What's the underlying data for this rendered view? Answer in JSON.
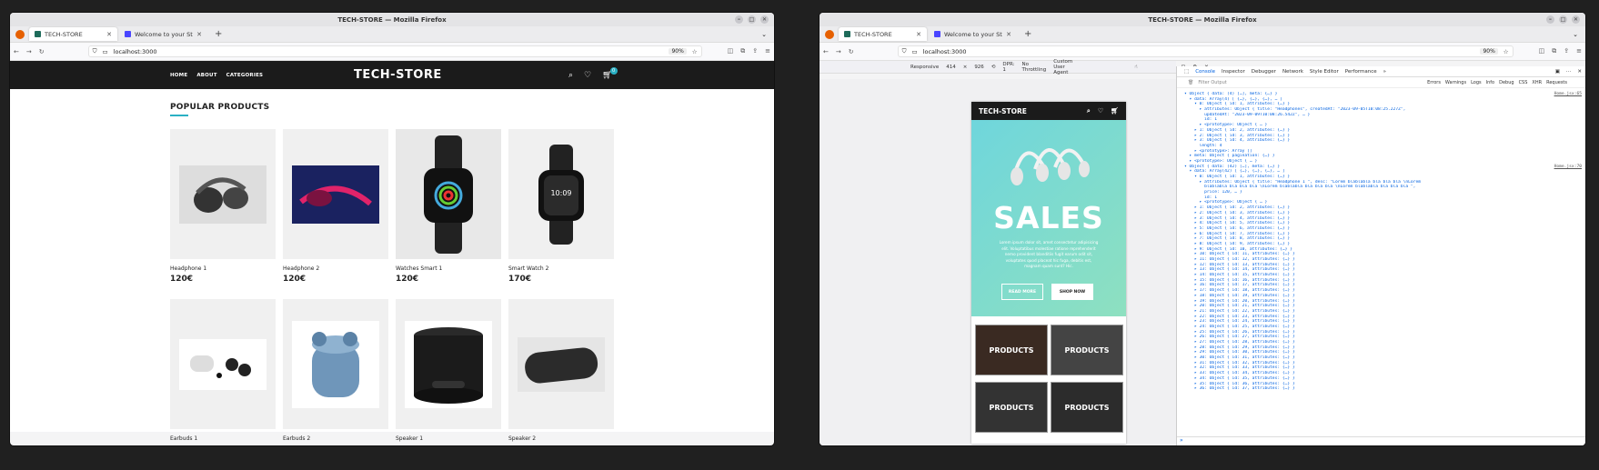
{
  "left_window": {
    "title": "TECH-STORE — Mozilla Firefox",
    "tabs": [
      {
        "label": "TECH-STORE"
      },
      {
        "label": "Welcome to your Strapi a"
      }
    ],
    "url": "localhost:3000",
    "zoom": "90%",
    "store": {
      "nav": [
        "HOME",
        "ABOUT",
        "CATEGORIES"
      ],
      "logo": "TECH-STORE",
      "cart_count": "0",
      "section_title": "POPULAR PRODUCTS",
      "products": [
        {
          "name": "Headphone 1",
          "price": "120€",
          "icon": "headphone-icon"
        },
        {
          "name": "Headphone 2",
          "price": "120€",
          "icon": "headphone-icon"
        },
        {
          "name": "Watches Smart 1",
          "price": "120€",
          "icon": "watch-icon"
        },
        {
          "name": "Smart Watch 2",
          "price": "170€",
          "icon": "watch-icon"
        },
        {
          "name": "Earbuds 1",
          "price": "",
          "icon": "earbuds-icon"
        },
        {
          "name": "Earbuds 2",
          "price": "",
          "icon": "earbuds-icon"
        },
        {
          "name": "Speaker 1",
          "price": "",
          "icon": "speaker-icon"
        },
        {
          "name": "Speaker 2",
          "price": "",
          "icon": "speaker-icon"
        }
      ]
    }
  },
  "right_window": {
    "title": "TECH-STORE — Mozilla Firefox",
    "tabs": [
      {
        "label": "TECH-STORE"
      },
      {
        "label": "Welcome to your Strapi a"
      }
    ],
    "url": "localhost:3000",
    "zoom": "90%",
    "rdm": {
      "device": "Responsive",
      "width": "414",
      "height": "926",
      "dpr": "DPR: 1",
      "throttle": "No Throttling",
      "ua": "Custom User Agent"
    },
    "phone": {
      "logo": "TECH-STORE",
      "hero_title": "SALES",
      "hero_text": "Lorem ipsum dolor sit, amet consectetur adipisicing elit. Voluptatibus molestiae ratione reprehenderit nemo provident blanditiis fugit earum odit sit, voluptates quod placeat hic fuga, debitis est, magnam quam sunt? Hic.",
      "read_more": "READ MORE",
      "shop_now": "SHOP NOW",
      "categories": [
        "PRODUCTS",
        "PRODUCTS",
        "PRODUCTS",
        "PRODUCTS"
      ]
    },
    "devtools": {
      "tabs": [
        "Console",
        "Inspector",
        "Debugger",
        "Network",
        "Style Editor",
        "Performance"
      ],
      "filter_placeholder": "Filter Output",
      "levels": [
        "Errors",
        "Warnings",
        "Logs",
        "Info",
        "Debug",
        "CSS",
        "XHR",
        "Requests"
      ],
      "source1": "Home.jsx:65",
      "source2": "Home.jsx:70",
      "log_lines": [
        "▾ Object { data: (4) […], meta: {…} }",
        "  ▾ data: Array(4) [ {…}, {…}, {…}, … ]",
        "    ▾ 0: Object { id: 1, attributes: {…} }",
        "      ▸ attributes: Object { title: \"Headphones\", createdAt: \"2023-09-05T10:08:25.227Z\",",
        "        updatedAt: \"2023-09-09T10:08:26.542Z\", … }",
        "        id: 1",
        "      ▸ <prototype>: Object { … }",
        "    ▸ 1: Object { id: 2, attributes: {…} }",
        "    ▸ 2: Object { id: 3, attributes: {…} }",
        "    ▸ 3: Object { id: 4, attributes: {…} }",
        "      length: 4",
        "    ▸ <prototype>: Array []",
        "  ▸ meta: Object { pagination: {…} }",
        "  ▸ <prototype>: Object { … }",
        "▾ Object { data: (42) […], meta: {…} }",
        "  ▾ data: Array(42) [ {…}, {…}, {…}, … ]",
        "    ▾ 0: Object { id: 1, attributes: {…} }",
        "      ▸ attributes: Object { title: \"Headphone 1 \", desc: \"Lorem blablabla bla bla bla \\nLorem",
        "        blablabla bla bla bla \\nLorem blablabla bla bla bla \\nLorem blablabla bla bla bla \",",
        "        price: 120, … }",
        "        id: 1",
        "      ▸ <prototype>: Object { … }",
        "    ▸ 1: Object { id: 2, attributes: {…} }",
        "    ▸ 2: Object { id: 3, attributes: {…} }",
        "    ▸ 3: Object { id: 4, attributes: {…} }",
        "    ▸ 4: Object { id: 5, attributes: {…} }",
        "    ▸ 5: Object { id: 6, attributes: {…} }",
        "    ▸ 6: Object { id: 7, attributes: {…} }",
        "    ▸ 7: Object { id: 8, attributes: {…} }",
        "    ▸ 8: Object { id: 9, attributes: {…} }",
        "    ▸ 9: Object { id: 10, attributes: {…} }",
        "    ▸ 10: Object { id: 11, attributes: {…} }",
        "    ▸ 11: Object { id: 12, attributes: {…} }",
        "    ▸ 12: Object { id: 13, attributes: {…} }",
        "    ▸ 13: Object { id: 14, attributes: {…} }",
        "    ▸ 14: Object { id: 15, attributes: {…} }",
        "    ▸ 15: Object { id: 16, attributes: {…} }",
        "    ▸ 16: Object { id: 17, attributes: {…} }",
        "    ▸ 17: Object { id: 18, attributes: {…} }",
        "    ▸ 18: Object { id: 19, attributes: {…} }",
        "    ▸ 19: Object { id: 20, attributes: {…} }",
        "    ▸ 20: Object { id: 21, attributes: {…} }",
        "    ▸ 21: Object { id: 22, attributes: {…} }",
        "    ▸ 22: Object { id: 23, attributes: {…} }",
        "    ▸ 23: Object { id: 24, attributes: {…} }",
        "    ▸ 24: Object { id: 25, attributes: {…} }",
        "    ▸ 25: Object { id: 26, attributes: {…} }",
        "    ▸ 26: Object { id: 27, attributes: {…} }",
        "    ▸ 27: Object { id: 28, attributes: {…} }",
        "    ▸ 28: Object { id: 29, attributes: {…} }",
        "    ▸ 29: Object { id: 30, attributes: {…} }",
        "    ▸ 30: Object { id: 31, attributes: {…} }",
        "    ▸ 31: Object { id: 32, attributes: {…} }",
        "    ▸ 32: Object { id: 33, attributes: {…} }",
        "    ▸ 33: Object { id: 34, attributes: {…} }",
        "    ▸ 34: Object { id: 35, attributes: {…} }",
        "    ▸ 35: Object { id: 36, attributes: {…} }",
        "    ▸ 36: Object { id: 37, attributes: {…} }"
      ]
    }
  }
}
